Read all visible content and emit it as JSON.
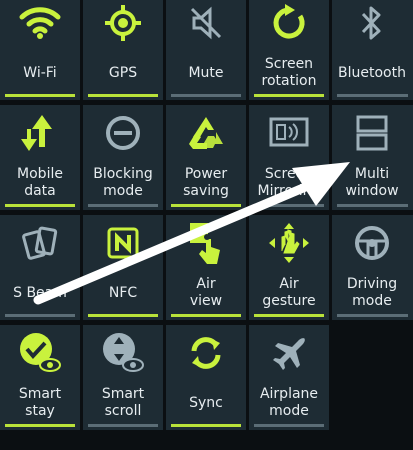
{
  "colors": {
    "active": "#c9f23d",
    "inactive": "#9fb1ba",
    "bar_on": "#b9e23a",
    "bar_off": "#5b6d76",
    "tile_bg": "#1e2c34"
  },
  "tiles": [
    {
      "label": "Wi-Fi",
      "icon": "wifi-icon",
      "active": true
    },
    {
      "label": "GPS",
      "icon": "gps-icon",
      "active": true
    },
    {
      "label": "Mute",
      "icon": "mute-icon",
      "active": false
    },
    {
      "label": "Screen\nrotation",
      "icon": "rotation-icon",
      "active": true
    },
    {
      "label": "Bluetooth",
      "icon": "bluetooth-icon",
      "active": false
    },
    {
      "label": "Mobile\ndata",
      "icon": "mobile-data-icon",
      "active": true
    },
    {
      "label": "Blocking\nmode",
      "icon": "blocking-icon",
      "active": false
    },
    {
      "label": "Power\nsaving",
      "icon": "recycle-icon",
      "active": true
    },
    {
      "label": "Screen\nMirroring",
      "icon": "screen-mirroring-icon",
      "active": false
    },
    {
      "label": "Multi\nwindow",
      "icon": "multi-window-icon",
      "active": false
    },
    {
      "label": "S Beam",
      "icon": "s-beam-icon",
      "active": false
    },
    {
      "label": "NFC",
      "icon": "nfc-icon",
      "active": true
    },
    {
      "label": "Air\nview",
      "icon": "air-view-icon",
      "active": true
    },
    {
      "label": "Air\ngesture",
      "icon": "air-gesture-icon",
      "active": true
    },
    {
      "label": "Driving\nmode",
      "icon": "steering-wheel-icon",
      "active": false
    },
    {
      "label": "Smart\nstay",
      "icon": "smart-stay-icon",
      "active": true
    },
    {
      "label": "Smart\nscroll",
      "icon": "smart-scroll-icon",
      "active": false
    },
    {
      "label": "Sync",
      "icon": "sync-icon",
      "active": true
    },
    {
      "label": "Airplane\nmode",
      "icon": "airplane-icon",
      "active": false
    }
  ]
}
